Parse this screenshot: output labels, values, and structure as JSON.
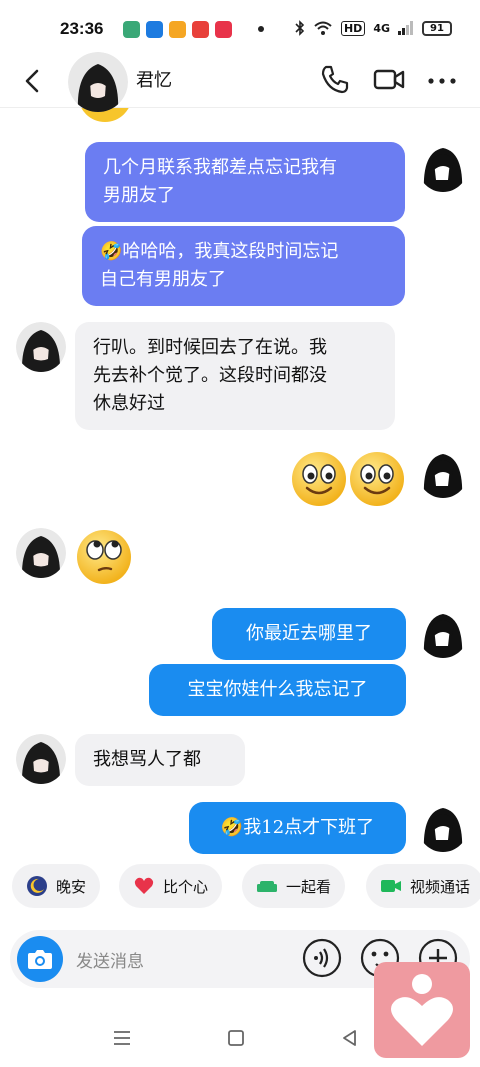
{
  "status": {
    "time": "23:36",
    "hd_label": "HD",
    "net_label": "4G",
    "battery": "91",
    "app_icons": [
      "#3aa877",
      "#1d7be0",
      "#f5a623",
      "#e8403a",
      "#e8334a"
    ]
  },
  "header": {
    "contact_name": "君忆"
  },
  "messages": [
    {
      "side": "right",
      "text": "几个月联系我都差点忘记我有男朋友了",
      "line1": "几个月联系我都差点忘记我有",
      "line2": "男朋友了"
    },
    {
      "side": "right",
      "text": "哈哈哈，我真这段时间忘记自己有男朋友了",
      "line1": "哈哈哈，我真这段时间忘记",
      "line2": "自己有男朋友了",
      "emoji": "🤣"
    },
    {
      "side": "left",
      "line1": "行叭。到时候回去了在说。我",
      "line2": "先去补个觉了。这段时间都没",
      "line3": "休息好过"
    },
    {
      "side": "right",
      "type": "emoji",
      "emoji_name": "smile-face"
    },
    {
      "side": "left",
      "type": "emoji",
      "emoji_name": "eye-roll-face"
    },
    {
      "side": "right",
      "text": "你最近去哪里了"
    },
    {
      "side": "right",
      "text": "宝宝你娃什么我忘记了"
    },
    {
      "side": "left",
      "text": "我想骂人了都"
    },
    {
      "side": "right",
      "text": "我12点才下班了",
      "emoji": "🤣"
    }
  ],
  "quick_replies": [
    {
      "label": "晚安",
      "icon": "moon-icon"
    },
    {
      "label": "比个心",
      "icon": "heart-icon"
    },
    {
      "label": "一起看",
      "icon": "sofa-icon"
    },
    {
      "label": "视频通话",
      "icon": "video-icon"
    }
  ],
  "input": {
    "placeholder": "发送消息"
  },
  "colors": {
    "purple_bubble": "#6b7df2",
    "blue_bubble": "#1a8cf0",
    "gray_bubble": "#f1f1f3",
    "heart_badge": "#ef9aa0"
  }
}
